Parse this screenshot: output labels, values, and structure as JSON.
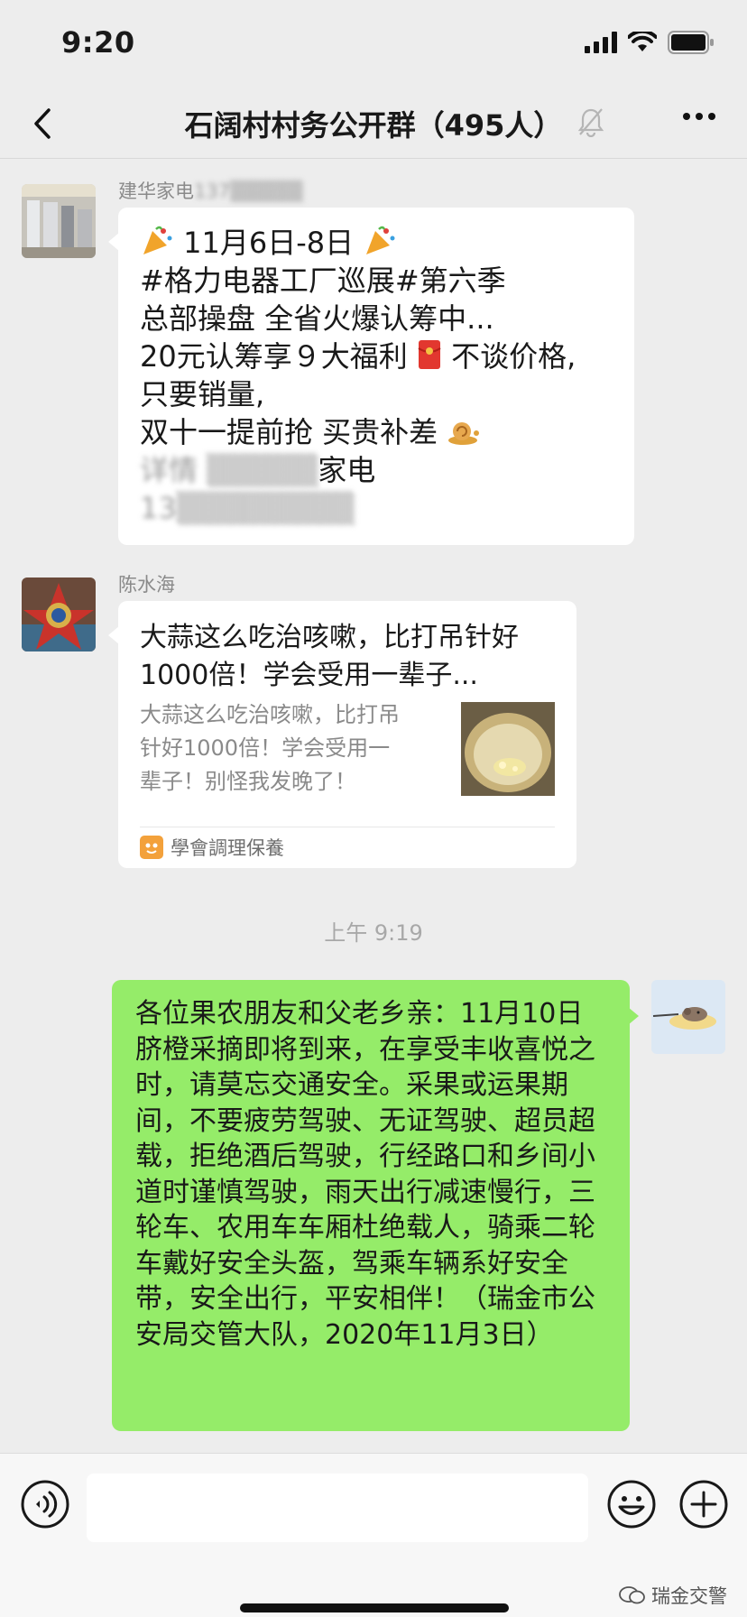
{
  "status_bar": {
    "time": "9:20"
  },
  "nav": {
    "title": "石阔村村务公开群（495人）"
  },
  "messages": [
    {
      "sender": "建华家电",
      "lines": [
        "11月6日-8日",
        "#格力电器工厂巡展#第六季",
        "总部操盘 全省火爆认筹中...",
        "20元认筹享９大福利",
        "不谈价格,",
        "只要销量,",
        "双十一提前抢 买贵补差"
      ],
      "blurred_suffix": "家电"
    },
    {
      "sender": "陈水海",
      "card_title": "大蒜这么吃治咳嗽，比打吊针好1000倍！学会受用一辈子...",
      "card_desc": "大蒜这么吃治咳嗽，比打吊针好1000倍！学会受用一辈子！别怪我发晚了！",
      "card_source": "學會調理保養"
    }
  ],
  "timestamp": "上午 9:19",
  "own_message": "各位果农朋友和父老乡亲：11月10日脐橙采摘即将到来，在享受丰收喜悦之时，请莫忘交通安全。采果或运果期间，不要疲劳驾驶、无证驾驶、超员超载，拒绝酒后驾驶，行经路口和乡间小道时谨慎驾驶，雨天出行减速慢行，三轮车、农用车车厢杜绝载人，骑乘二轮车戴好安全头盔，驾乘车辆系好安全带，安全出行，平安相伴！（瑞金市公安局交管大队，2020年11月3日）",
  "watermark": "瑞金交警",
  "colors": {
    "own_bubble": "#95ec69",
    "background": "#ededed"
  }
}
